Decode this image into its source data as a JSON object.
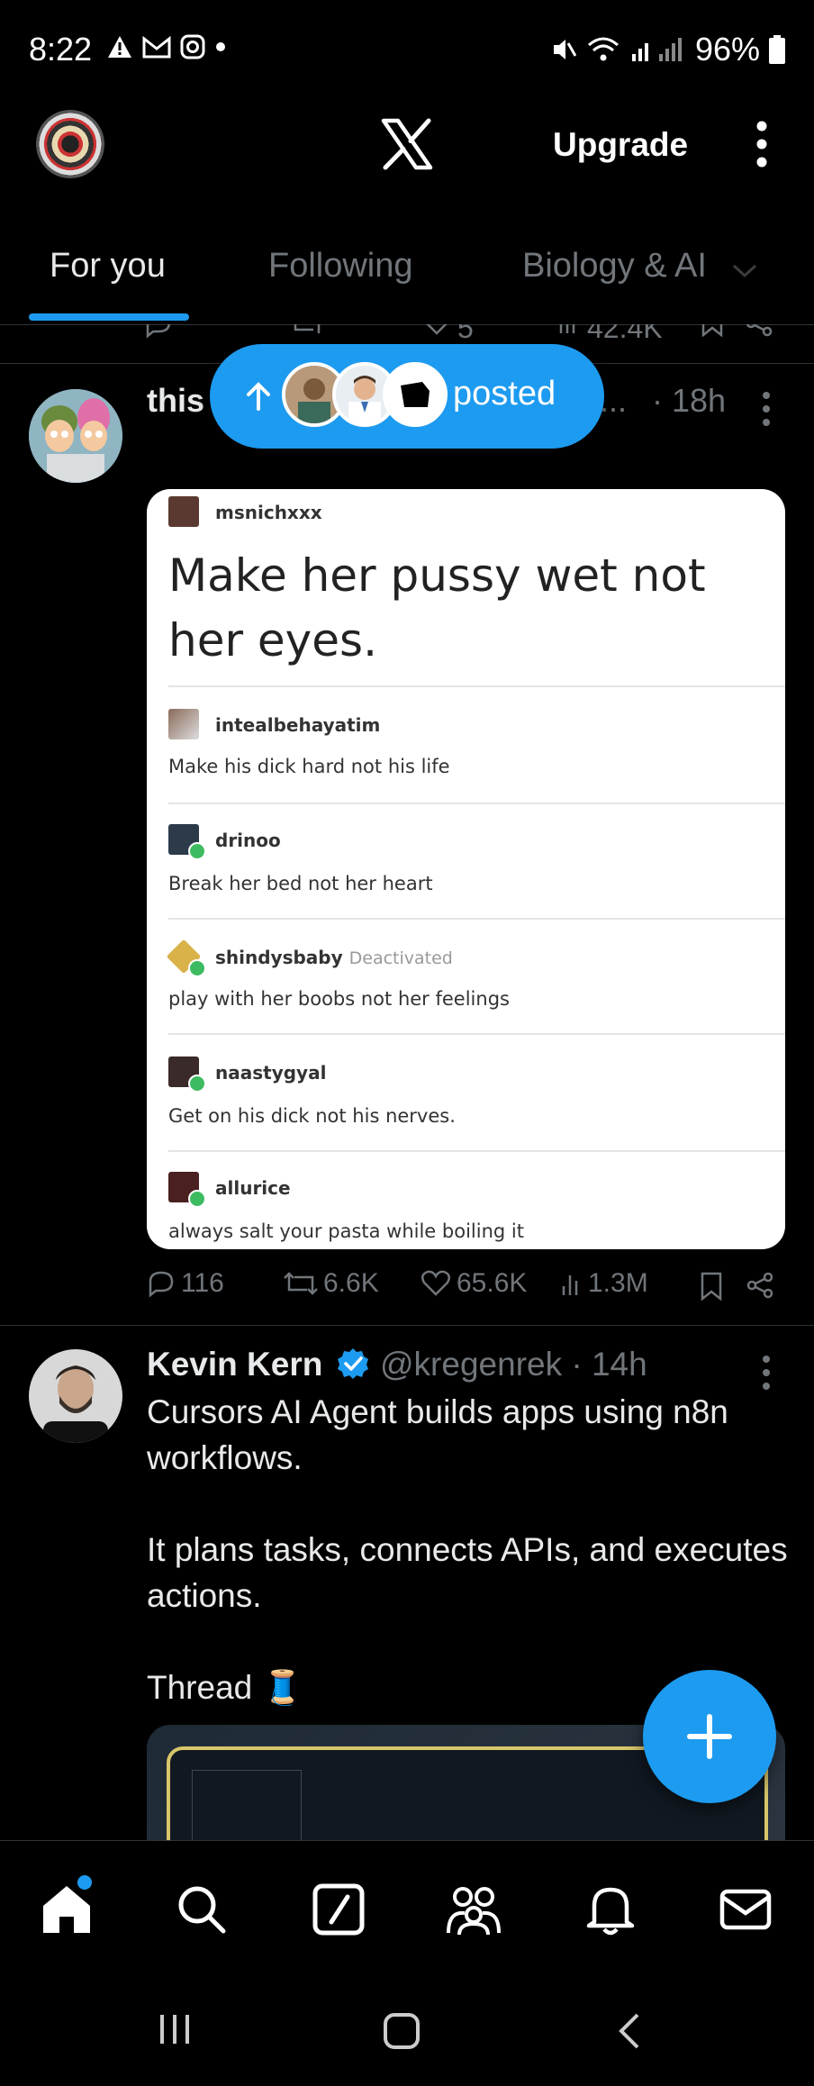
{
  "status_bar": {
    "time": "8:22",
    "battery": "96%"
  },
  "header": {
    "upgrade_label": "Upgrade"
  },
  "tabs": [
    {
      "label": "For you",
      "active": true
    },
    {
      "label": "Following",
      "active": false
    },
    {
      "label": "Biology & AI",
      "active": false
    }
  ],
  "prev_tweet": {
    "likes": "5",
    "views": "42.4K"
  },
  "new_posts_pill": {
    "label": "posted"
  },
  "tweet1": {
    "name_prefix": "this",
    "ellipsis": "...",
    "time": "· 18h",
    "image": {
      "op_user": "msnichxxx",
      "op_text": "Make her pussy wet not her eyes.",
      "comments": [
        {
          "user": "intealbehayatim",
          "text": "Make his dick hard not his life"
        },
        {
          "user": "drinoo",
          "text": "Break her bed not her heart"
        },
        {
          "user": "shindysbaby",
          "note": "Deactivated",
          "text": "play with her boobs not her feelings"
        },
        {
          "user": "naastygyal",
          "text": "Get on his dick not his nerves."
        },
        {
          "user": "allurice",
          "text": "always salt your pasta while boiling it"
        }
      ]
    },
    "actions": {
      "replies": "116",
      "reposts": "6.6K",
      "likes": "65.6K",
      "views": "1.3M"
    }
  },
  "tweet2": {
    "name": "Kevin Kern",
    "handle_time": "@kregenrek · 14h",
    "body": "Cursors AI Agent builds apps using n8n workflows.\n\nIt plans tasks, connects APIs, and executes actions.\n\nThread 🧵"
  },
  "colors": {
    "accent": "#1d9bf0",
    "muted": "#71767b",
    "text": "#e7e9ea",
    "divider": "#2f3336"
  }
}
